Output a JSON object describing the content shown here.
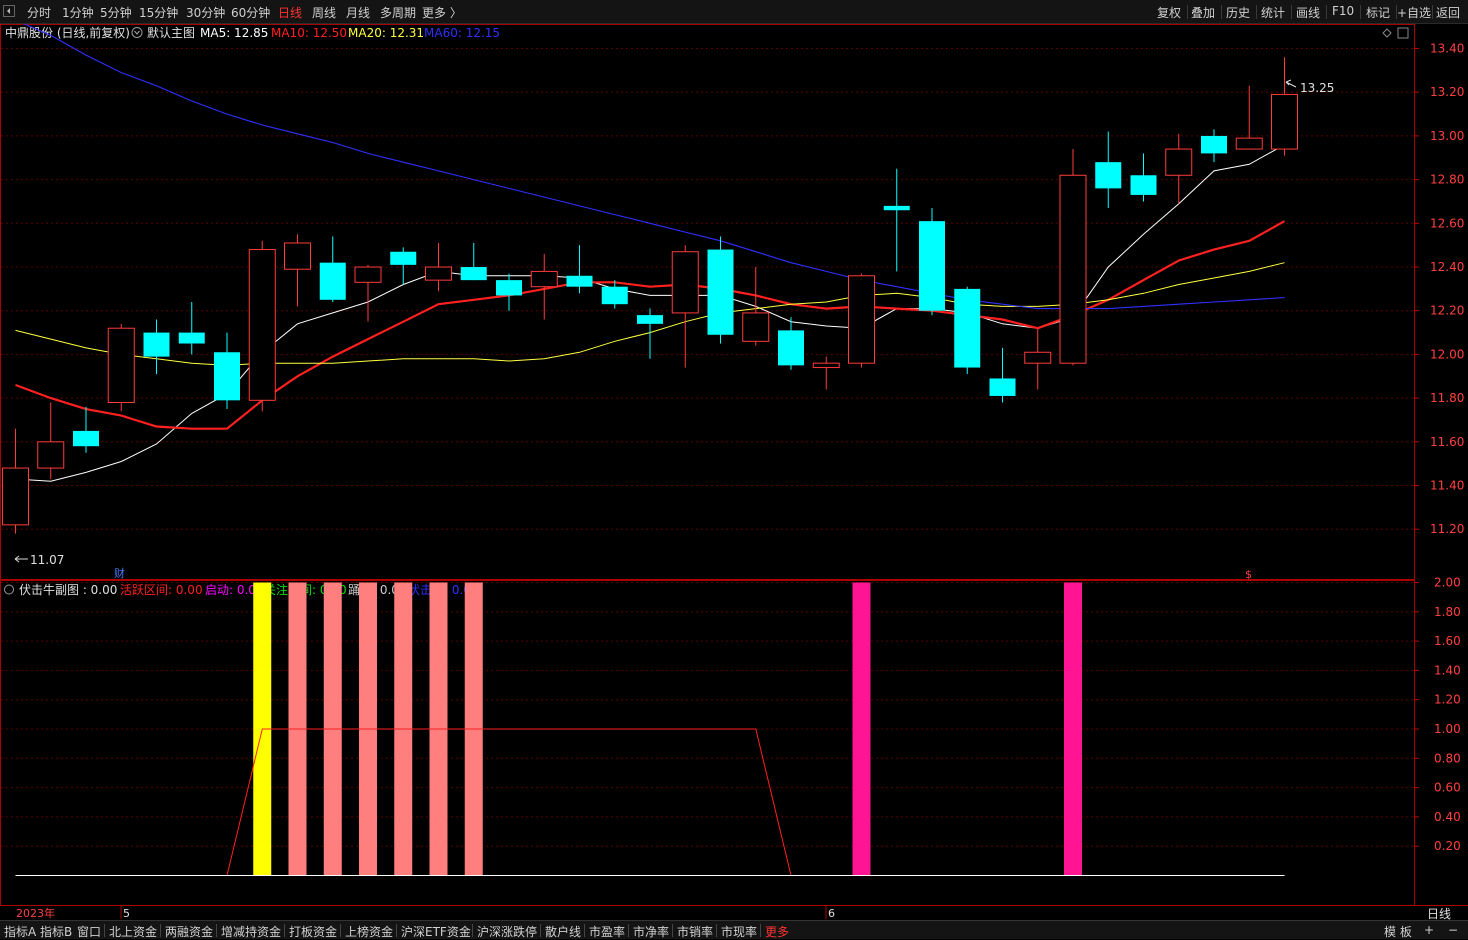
{
  "toolbar": {
    "periods": [
      "分时",
      "1分钟",
      "5分钟",
      "15分钟",
      "30分钟",
      "60分钟",
      "日线",
      "周线",
      "月线",
      "多周期",
      "更多 〉"
    ],
    "active_period": "日线",
    "right_tools": [
      "复权",
      "叠加",
      "历史",
      "统计",
      "画线",
      "F10",
      "标记",
      "+自选",
      "返回"
    ]
  },
  "header": {
    "stock": "中鼎股份 (日线,前复权)",
    "template": "默认主图",
    "ma5": {
      "label": "MA5: 12.85",
      "color": "#ffffff"
    },
    "ma10": {
      "label": "MA10: 12.50",
      "color": "#ff2020"
    },
    "ma20": {
      "label": "MA20: 12.31",
      "color": "#ffff40"
    },
    "ma60": {
      "label": "MA60: 12.15",
      "color": "#3030ff"
    }
  },
  "price_axis": [
    "13.40",
    "13.20",
    "13.00",
    "12.80",
    "12.60",
    "12.40",
    "12.20",
    "12.00",
    "11.80",
    "11.60",
    "11.40",
    "11.20"
  ],
  "annotations": {
    "high": "13.25",
    "low": "11.07",
    "finance_mark": "财",
    "dividend_mark": "$"
  },
  "sub_header": {
    "title": "伏击牛副图 : 0.00",
    "items": [
      {
        "label": "活跃区间: 0.00",
        "color": "#ff2020"
      },
      {
        "label": "启动: 0.00",
        "color": "#ff00ff"
      },
      {
        "label": "关注区间: 0.00",
        "color": "#00e000"
      },
      {
        "label": "踊极: 0.00",
        "color": "#d0d0d0"
      },
      {
        "label": "伏击牛: 0.00",
        "color": "#3030ff"
      }
    ]
  },
  "sub_axis": [
    "2.00",
    "1.80",
    "1.60",
    "1.40",
    "1.20",
    "1.00",
    "0.80",
    "0.60",
    "0.40",
    "0.20"
  ],
  "date_axis": {
    "year": "2023年",
    "month5": "5",
    "month6": "6",
    "right_label": "日线"
  },
  "bottom_tabs": [
    "指标A",
    "指标B",
    "窗口",
    "北上资金",
    "两融资金",
    "增减持资金",
    "打板资金",
    "上榜资金",
    "沪深ETF资金",
    "沪深涨跌停",
    "散户线",
    "市盈率",
    "市净率",
    "市销率",
    "市现率",
    "更多"
  ],
  "bottom_right": [
    "模 板",
    "+",
    "−"
  ],
  "colors": {
    "up": "#ff3b3b",
    "down": "#00ffff",
    "grid": "#5a0000",
    "axis": "#c00000"
  },
  "chart_data": [
    {
      "type": "candlestick",
      "title": "中鼎股份 (日线,前复权)",
      "ylim": [
        11.07,
        13.45
      ],
      "candles": [
        {
          "o": 11.11,
          "h": 11.55,
          "l": 11.07,
          "c": 11.37
        },
        {
          "o": 11.37,
          "h": 11.67,
          "l": 11.32,
          "c": 11.49
        },
        {
          "o": 11.54,
          "h": 11.65,
          "l": 11.44,
          "c": 11.47
        },
        {
          "o": 11.67,
          "h": 12.03,
          "l": 11.63,
          "c": 12.01
        },
        {
          "o": 11.99,
          "h": 12.05,
          "l": 11.8,
          "c": 11.88
        },
        {
          "o": 11.99,
          "h": 12.13,
          "l": 11.89,
          "c": 11.94
        },
        {
          "o": 11.9,
          "h": 11.99,
          "l": 11.64,
          "c": 11.68
        },
        {
          "o": 11.68,
          "h": 12.41,
          "l": 11.63,
          "c": 12.37
        },
        {
          "o": 12.28,
          "h": 12.44,
          "l": 12.11,
          "c": 12.4
        },
        {
          "o": 12.31,
          "h": 12.43,
          "l": 12.13,
          "c": 12.14
        },
        {
          "o": 12.22,
          "h": 12.3,
          "l": 12.04,
          "c": 12.29
        },
        {
          "o": 12.36,
          "h": 12.38,
          "l": 12.21,
          "c": 12.3
        },
        {
          "o": 12.23,
          "h": 12.4,
          "l": 12.18,
          "c": 12.29
        },
        {
          "o": 12.29,
          "h": 12.4,
          "l": 12.23,
          "c": 12.23
        },
        {
          "o": 12.23,
          "h": 12.26,
          "l": 12.09,
          "c": 12.16
        },
        {
          "o": 12.2,
          "h": 12.35,
          "l": 12.05,
          "c": 12.27
        },
        {
          "o": 12.25,
          "h": 12.39,
          "l": 12.17,
          "c": 12.2
        },
        {
          "o": 12.2,
          "h": 12.23,
          "l": 12.1,
          "c": 12.12
        },
        {
          "o": 12.07,
          "h": 12.1,
          "l": 11.87,
          "c": 12.03
        },
        {
          "o": 12.08,
          "h": 12.39,
          "l": 11.83,
          "c": 12.36
        },
        {
          "o": 12.37,
          "h": 12.43,
          "l": 11.94,
          "c": 11.98
        },
        {
          "o": 11.95,
          "h": 12.29,
          "l": 11.93,
          "c": 12.08
        },
        {
          "o": 12.0,
          "h": 12.06,
          "l": 11.82,
          "c": 11.84
        },
        {
          "o": 11.83,
          "h": 11.88,
          "l": 11.73,
          "c": 11.85
        },
        {
          "o": 11.85,
          "h": 12.26,
          "l": 11.83,
          "c": 12.25
        },
        {
          "o": 12.57,
          "h": 12.74,
          "l": 12.27,
          "c": 12.55
        },
        {
          "o": 12.5,
          "h": 12.56,
          "l": 12.07,
          "c": 12.09
        },
        {
          "o": 12.19,
          "h": 12.2,
          "l": 11.8,
          "c": 11.83
        },
        {
          "o": 11.78,
          "h": 11.92,
          "l": 11.67,
          "c": 11.7
        },
        {
          "o": 11.85,
          "h": 12.01,
          "l": 11.73,
          "c": 11.9
        },
        {
          "o": 11.85,
          "h": 12.83,
          "l": 11.84,
          "c": 12.71
        },
        {
          "o": 12.77,
          "h": 12.91,
          "l": 12.56,
          "c": 12.65
        },
        {
          "o": 12.71,
          "h": 12.81,
          "l": 12.59,
          "c": 12.62
        },
        {
          "o": 12.71,
          "h": 12.9,
          "l": 12.58,
          "c": 12.83
        },
        {
          "o": 12.89,
          "h": 12.92,
          "l": 12.77,
          "c": 12.81
        },
        {
          "o": 12.83,
          "h": 13.12,
          "l": 12.83,
          "c": 12.88
        },
        {
          "o": 12.83,
          "h": 13.25,
          "l": 12.8,
          "c": 13.08
        }
      ],
      "series": [
        {
          "name": "MA5",
          "values": [
            11.32,
            11.31,
            11.35,
            11.4,
            11.48,
            11.62,
            11.71,
            11.9,
            12.03,
            12.08,
            12.13,
            12.21,
            12.27,
            12.25,
            12.25,
            12.25,
            12.24,
            12.19,
            12.16,
            12.16,
            12.16,
            12.11,
            12.04,
            12.02,
            12.01,
            12.1,
            12.1,
            12.08,
            12.03,
            12.01,
            12.06,
            12.29,
            12.44,
            12.58,
            12.73,
            12.76,
            12.85
          ]
        },
        {
          "name": "MA10",
          "values": [
            11.75,
            11.69,
            11.64,
            11.61,
            11.56,
            11.55,
            11.55,
            11.68,
            11.79,
            11.88,
            11.96,
            12.04,
            12.12,
            12.14,
            12.16,
            12.19,
            12.22,
            12.22,
            12.2,
            12.21,
            12.19,
            12.16,
            12.12,
            12.1,
            12.11,
            12.1,
            12.09,
            12.07,
            12.05,
            12.01,
            12.07,
            12.14,
            12.23,
            12.32,
            12.37,
            12.41,
            12.5
          ]
        },
        {
          "name": "MA20",
          "values": [
            12.0,
            11.96,
            11.92,
            11.89,
            11.87,
            11.85,
            11.84,
            11.85,
            11.85,
            11.85,
            11.86,
            11.87,
            11.87,
            11.87,
            11.86,
            11.87,
            11.9,
            11.95,
            11.99,
            12.04,
            12.08,
            12.1,
            12.12,
            12.13,
            12.16,
            12.17,
            12.15,
            12.12,
            12.11,
            12.11,
            12.12,
            12.14,
            12.17,
            12.21,
            12.24,
            12.27,
            12.31
          ]
        },
        {
          "name": "MA60",
          "values": [
            13.42,
            13.35,
            13.26,
            13.18,
            13.12,
            13.05,
            12.99,
            12.94,
            12.9,
            12.86,
            12.81,
            12.77,
            12.73,
            12.69,
            12.65,
            12.61,
            12.57,
            12.53,
            12.49,
            12.45,
            12.41,
            12.36,
            12.31,
            12.27,
            12.23,
            12.2,
            12.17,
            12.14,
            12.12,
            12.1,
            12.1,
            12.1,
            12.11,
            12.12,
            12.13,
            12.14,
            12.15
          ]
        }
      ]
    },
    {
      "type": "bar",
      "title": "伏击牛副图",
      "ylim": [
        0,
        2.05
      ],
      "bars": [
        {
          "index": 7,
          "value": 2.0,
          "color": "#ffff00"
        },
        {
          "index": 8,
          "value": 2.0,
          "color": "#ff7f7f"
        },
        {
          "index": 9,
          "value": 2.0,
          "color": "#ff7f7f"
        },
        {
          "index": 10,
          "value": 2.0,
          "color": "#ff7f7f"
        },
        {
          "index": 11,
          "value": 2.0,
          "color": "#ff7f7f"
        },
        {
          "index": 12,
          "value": 2.0,
          "color": "#ff7f7f"
        },
        {
          "index": 13,
          "value": 2.0,
          "color": "#ff7f7f"
        },
        {
          "index": 24,
          "value": 2.0,
          "color": "#ff1493"
        },
        {
          "index": 30,
          "value": 2.0,
          "color": "#ff1493"
        }
      ],
      "line": {
        "name": "活跃区间",
        "values": [
          0,
          0,
          0,
          0,
          0,
          0,
          0,
          1,
          1,
          1,
          1,
          1,
          1,
          1,
          1,
          1,
          1,
          1,
          1,
          1,
          1,
          1,
          0,
          0,
          0,
          0,
          0,
          0,
          0,
          0,
          0,
          0,
          0,
          0,
          0,
          0,
          0
        ]
      }
    }
  ]
}
